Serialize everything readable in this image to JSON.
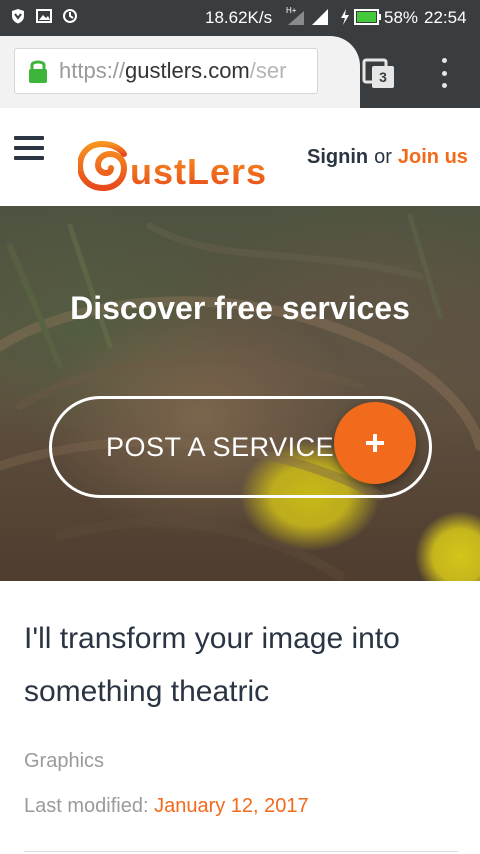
{
  "status_bar": {
    "net_speed": "18.62K/s",
    "network_type": "H+",
    "battery_percent": "58%",
    "time": "22:54",
    "icons": [
      "shield-icon",
      "image-icon",
      "alarm-icon",
      "signal-icon",
      "signal-icon",
      "charging-icon",
      "battery-icon"
    ]
  },
  "browser": {
    "url_scheme": "https://",
    "url_host": "gustlers.com",
    "url_path": "/ser",
    "tab_count": "3",
    "icons": [
      "lock-icon",
      "tabs-icon",
      "overflow-menu-icon"
    ]
  },
  "header": {
    "logo_text": "Gustlers",
    "signin_label": "Signin",
    "or_label": "or",
    "join_label": "Join us",
    "icons": [
      "hamburger-menu-icon"
    ]
  },
  "hero": {
    "title": "Discover free services",
    "post_button_label": "POST A SERVICE",
    "icons": [
      "plus-icon"
    ]
  },
  "gig": {
    "title": "I'll transform your image into something theatric",
    "category": "Graphics",
    "modified_label": "Last modified:",
    "modified_date": "January 12, 2017"
  },
  "colors": {
    "brand_orange": "#f26a1b",
    "text_dark": "#2a3442",
    "chrome_dark": "#3a3d40"
  }
}
